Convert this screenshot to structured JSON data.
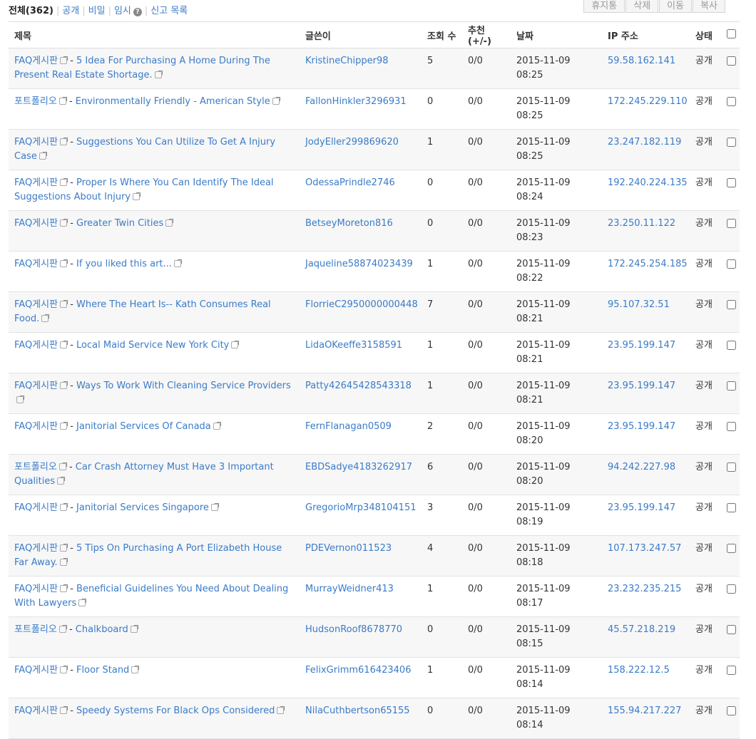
{
  "filters": {
    "all": "전체(362)",
    "public": "공개",
    "secret": "비밀",
    "temp": "임시",
    "report": "신고 목록"
  },
  "actions": [
    "휴지통",
    "삭제",
    "이동",
    "복사"
  ],
  "columns": [
    "제목",
    "글쓴이",
    "조회 수",
    "추천(+/-)",
    "날짜",
    "IP 주소",
    "상태"
  ],
  "rows": [
    {
      "category": "FAQ게시판",
      "title": "5 Idea For Purchasing A Home During The Present Real Estate Shortage.",
      "author": "KristineChipper98",
      "views": "5",
      "votes": "0/0",
      "date": "2015-11-09 08:25",
      "ip": "59.58.162.141",
      "status": "공개"
    },
    {
      "category": "포트폴리오",
      "title": "Environmentally Friendly - American Style",
      "author": "FallonHinkler3296931",
      "views": "0",
      "votes": "0/0",
      "date": "2015-11-09 08:25",
      "ip": "172.245.229.110",
      "status": "공개"
    },
    {
      "category": "FAQ게시판",
      "title": "Suggestions You Can Utilize To Get A Injury Case",
      "author": "JodyEller299869620",
      "views": "1",
      "votes": "0/0",
      "date": "2015-11-09 08:25",
      "ip": "23.247.182.119",
      "status": "공개"
    },
    {
      "category": "FAQ게시판",
      "title": "Proper Is Where You Can Identify The Ideal Suggestions About Injury",
      "author": "OdessaPrindle2746",
      "views": "0",
      "votes": "0/0",
      "date": "2015-11-09 08:24",
      "ip": "192.240.224.135",
      "status": "공개"
    },
    {
      "category": "FAQ게시판",
      "title": "Greater Twin Cities",
      "author": "BetseyMoreton816",
      "views": "0",
      "votes": "0/0",
      "date": "2015-11-09 08:23",
      "ip": "23.250.11.122",
      "status": "공개"
    },
    {
      "category": "FAQ게시판",
      "title": "If you liked this art...",
      "author": "Jaqueline58874023439",
      "views": "1",
      "votes": "0/0",
      "date": "2015-11-09 08:22",
      "ip": "172.245.254.185",
      "status": "공개"
    },
    {
      "category": "FAQ게시판",
      "title": "Where The Heart Is-- Kath Consumes Real Food.",
      "author": "FlorrieC2950000000448",
      "views": "7",
      "votes": "0/0",
      "date": "2015-11-09 08:21",
      "ip": "95.107.32.51",
      "status": "공개"
    },
    {
      "category": "FAQ게시판",
      "title": "Local Maid Service New York City",
      "author": "LidaOKeeffe3158591",
      "views": "1",
      "votes": "0/0",
      "date": "2015-11-09 08:21",
      "ip": "23.95.199.147",
      "status": "공개"
    },
    {
      "category": "FAQ게시판",
      "title": "Ways To Work With Cleaning Service Providers",
      "author": "Patty42645428543318",
      "views": "1",
      "votes": "0/0",
      "date": "2015-11-09 08:21",
      "ip": "23.95.199.147",
      "status": "공개"
    },
    {
      "category": "FAQ게시판",
      "title": "Janitorial Services Of Canada",
      "author": "FernFlanagan0509",
      "views": "2",
      "votes": "0/0",
      "date": "2015-11-09 08:20",
      "ip": "23.95.199.147",
      "status": "공개"
    },
    {
      "category": "포트폴리오",
      "title": "Car Crash Attorney Must Have 3 Important Qualities",
      "author": "EBDSadye4183262917",
      "views": "6",
      "votes": "0/0",
      "date": "2015-11-09 08:20",
      "ip": "94.242.227.98",
      "status": "공개"
    },
    {
      "category": "FAQ게시판",
      "title": "Janitorial Services Singapore",
      "author": "GregorioMrp348104151",
      "views": "3",
      "votes": "0/0",
      "date": "2015-11-09 08:19",
      "ip": "23.95.199.147",
      "status": "공개"
    },
    {
      "category": "FAQ게시판",
      "title": "5 Tips On Purchasing A Port Elizabeth House Far Away.",
      "author": "PDEVernon011523",
      "views": "4",
      "votes": "0/0",
      "date": "2015-11-09 08:18",
      "ip": "107.173.247.57",
      "status": "공개"
    },
    {
      "category": "FAQ게시판",
      "title": "Beneficial Guidelines You Need About Dealing With Lawyers",
      "author": "MurrayWeidner413",
      "views": "1",
      "votes": "0/0",
      "date": "2015-11-09 08:17",
      "ip": "23.232.235.215",
      "status": "공개"
    },
    {
      "category": "포트폴리오",
      "title": "Chalkboard",
      "author": "HudsonRoof8678770",
      "views": "0",
      "votes": "0/0",
      "date": "2015-11-09 08:15",
      "ip": "45.57.218.219",
      "status": "공개"
    },
    {
      "category": "FAQ게시판",
      "title": "Floor Stand",
      "author": "FelixGrimm616423406",
      "views": "1",
      "votes": "0/0",
      "date": "2015-11-09 08:14",
      "ip": "158.222.12.5",
      "status": "공개"
    },
    {
      "category": "FAQ게시판",
      "title": "Speedy Systems For Black Ops Considered",
      "author": "NilaCuthbertson65155",
      "views": "0",
      "votes": "0/0",
      "date": "2015-11-09 08:14",
      "ip": "155.94.217.227",
      "status": "공개"
    }
  ]
}
